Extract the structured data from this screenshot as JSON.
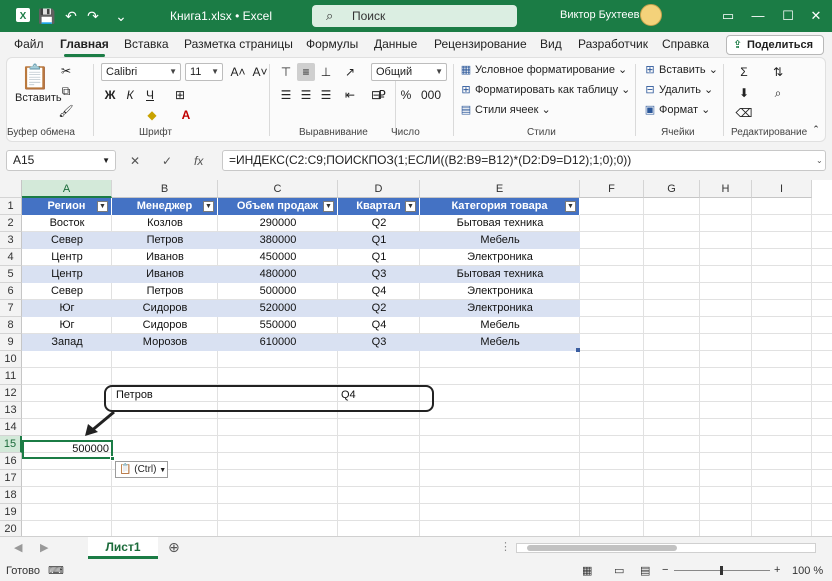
{
  "titlebar": {
    "filename": "Книга1.xlsx",
    "separator": "•",
    "app": "Excel",
    "search_placeholder": "Поиск",
    "user": "Виктор Бухтеев"
  },
  "menu": {
    "tabs": [
      "Файл",
      "Главная",
      "Вставка",
      "Разметка страницы",
      "Формулы",
      "Данные",
      "Рецензирование",
      "Вид",
      "Разработчик",
      "Справка"
    ],
    "active": "Главная",
    "share": "Поделиться"
  },
  "ribbon": {
    "clipboard": {
      "label": "Буфер обмена",
      "paste": "Вставить"
    },
    "font": {
      "label": "Шрифт",
      "name": "Calibri",
      "size": "11",
      "bold": "Ж",
      "italic": "К",
      "underline": "Ч"
    },
    "alignment": {
      "label": "Выравнивание"
    },
    "number": {
      "label": "Число",
      "format": "Общий"
    },
    "styles": {
      "label": "Стили",
      "conditional": "Условное форматирование",
      "as_table": "Форматировать как таблицу",
      "cell_styles": "Стили ячеек"
    },
    "cells": {
      "label": "Ячейки",
      "insert": "Вставить",
      "delete": "Удалить",
      "format": "Формат"
    },
    "editing": {
      "label": "Редактирование"
    }
  },
  "formula_bar": {
    "name_box": "A15",
    "fx": "fx",
    "formula": "=ИНДЕКС(C2:C9;ПОИСКПОЗ(1;ЕСЛИ((B2:B9=B12)*(D2:D9=D12);1;0);0))"
  },
  "grid": {
    "columns": [
      "A",
      "B",
      "C",
      "D",
      "E",
      "F",
      "G",
      "H",
      "I"
    ],
    "rows": [
      "1",
      "2",
      "3",
      "4",
      "5",
      "6",
      "7",
      "8",
      "9",
      "10",
      "11",
      "12",
      "13",
      "14",
      "15",
      "16",
      "17",
      "18",
      "19",
      "20"
    ],
    "headers": [
      "Регион",
      "Менеджер",
      "Объем продаж",
      "Квартал",
      "Категория товара"
    ],
    "data": [
      [
        "Восток",
        "Козлов",
        "290000",
        "Q2",
        "Бытовая техника"
      ],
      [
        "Север",
        "Петров",
        "380000",
        "Q1",
        "Мебель"
      ],
      [
        "Центр",
        "Иванов",
        "450000",
        "Q1",
        "Электроника"
      ],
      [
        "Центр",
        "Иванов",
        "480000",
        "Q3",
        "Бытовая техника"
      ],
      [
        "Север",
        "Петров",
        "500000",
        "Q4",
        "Электроника"
      ],
      [
        "Юг",
        "Сидоров",
        "520000",
        "Q2",
        "Электроника"
      ],
      [
        "Юг",
        "Сидоров",
        "550000",
        "Q4",
        "Мебель"
      ],
      [
        "Запад",
        "Морозов",
        "610000",
        "Q3",
        "Мебель"
      ]
    ],
    "b12": "Петров",
    "d12": "Q4",
    "a15": "500000",
    "paste_options": "(Ctrl)"
  },
  "sheets": {
    "active": "Лист1"
  },
  "status": {
    "ready": "Готово",
    "zoom": "100 %"
  }
}
